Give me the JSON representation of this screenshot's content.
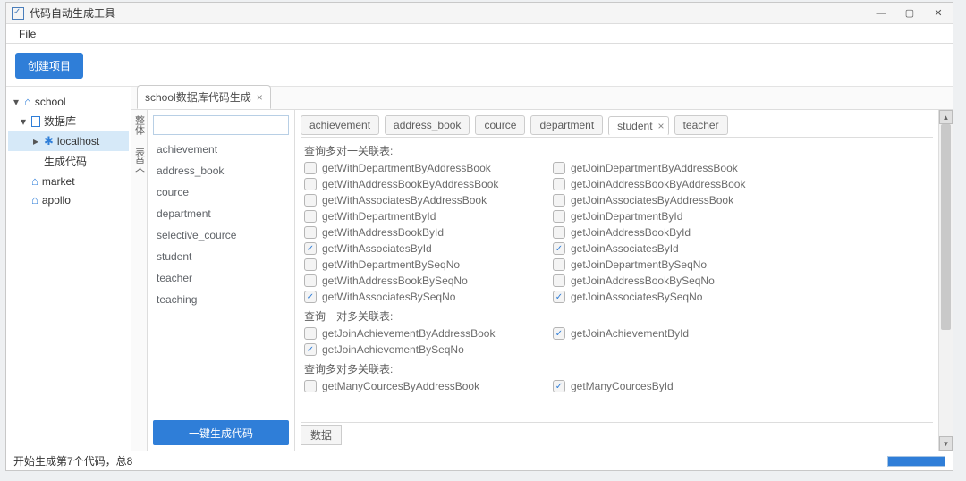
{
  "window": {
    "title": "代码自动生成工具"
  },
  "menu": {
    "file": "File"
  },
  "toolbar": {
    "create_project": "创建项目"
  },
  "tree": {
    "items": [
      {
        "name": "school",
        "icon": "home",
        "level": 0,
        "caret": "▾"
      },
      {
        "name": "数据库",
        "icon": "db",
        "level": 1,
        "caret": "▾"
      },
      {
        "name": "localhost",
        "icon": "bluetooth",
        "level": 2,
        "caret": "▸",
        "selected": true
      },
      {
        "name": "生成代码",
        "icon": "",
        "level": 2
      },
      {
        "name": "market",
        "icon": "home",
        "level": 1
      },
      {
        "name": "apollo",
        "icon": "home",
        "level": 1
      }
    ]
  },
  "tabs": {
    "main": "school数据库代码生成"
  },
  "vtabs": [
    "整体",
    "表单个"
  ],
  "tables": [
    "achievement",
    "address_book",
    "cource",
    "department",
    "selective_cource",
    "student",
    "teacher",
    "teaching"
  ],
  "buttons": {
    "generate": "一键生成代码"
  },
  "subtabs": [
    "achievement",
    "address_book",
    "cource",
    "department",
    "student",
    "teacher"
  ],
  "active_subtab": "student",
  "sections": {
    "s1": "查询多对一关联表:",
    "s2": "查询一对多关联表:",
    "s3": "查询多对多关联表:"
  },
  "group1": [
    {
      "l": "getWithDepartmentByAddressBook",
      "lc": false,
      "r": "getJoinDepartmentByAddressBook",
      "rc": false
    },
    {
      "l": "getWithAddressBookByAddressBook",
      "lc": false,
      "r": "getJoinAddressBookByAddressBook",
      "rc": false
    },
    {
      "l": "getWithAssociatesByAddressBook",
      "lc": false,
      "r": "getJoinAssociatesByAddressBook",
      "rc": false
    },
    {
      "l": "getWithDepartmentById",
      "lc": false,
      "r": "getJoinDepartmentById",
      "rc": false
    },
    {
      "l": "getWithAddressBookById",
      "lc": false,
      "r": "getJoinAddressBookById",
      "rc": false
    },
    {
      "l": "getWithAssociatesById",
      "lc": true,
      "r": "getJoinAssociatesById",
      "rc": true
    },
    {
      "l": "getWithDepartmentBySeqNo",
      "lc": false,
      "r": "getJoinDepartmentBySeqNo",
      "rc": false
    },
    {
      "l": "getWithAddressBookBySeqNo",
      "lc": false,
      "r": "getJoinAddressBookBySeqNo",
      "rc": false
    },
    {
      "l": "getWithAssociatesBySeqNo",
      "lc": true,
      "r": "getJoinAssociatesBySeqNo",
      "rc": true
    }
  ],
  "group2": [
    {
      "l": "getJoinAchievementByAddressBook",
      "lc": false,
      "r": "getJoinAchievementById",
      "rc": true
    },
    {
      "l": "getJoinAchievementBySeqNo",
      "lc": true,
      "r": "",
      "rc": false
    }
  ],
  "group3": [
    {
      "l": "getManyCourcesByAddressBook",
      "lc": false,
      "r": "getManyCourcesById",
      "rc": true
    }
  ],
  "bottom_tab": "数据",
  "status": {
    "text": "开始生成第7个代码，总8"
  }
}
